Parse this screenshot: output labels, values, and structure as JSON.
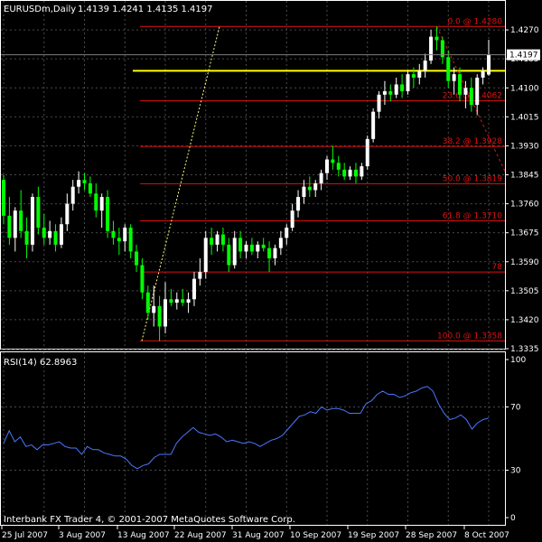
{
  "header": {
    "symbol": "EURUSDm,Daily",
    "ohlc": "1.4139 1.4241 1.4135 1.4197"
  },
  "rsi_header": "RSI(14) 62.8963",
  "footer": "Interbank FX Trader 4, © 2001-2007 MetaQuotes Software Corp.",
  "current_price_label": "1.4197",
  "colors": {
    "background": "#000000",
    "frame": "#ffffff",
    "bull": "#ffffff",
    "bear": "#00ff00",
    "fib": "#e01010",
    "horizontal_line": "#ffff00",
    "rsi": "#4a78ff"
  },
  "chart_data": [
    {
      "type": "candlestick",
      "title": "EURUSDm,Daily",
      "ylim": [
        1.3335,
        1.4355
      ],
      "y_ticks": [
        "1.4270",
        "1.4185",
        "1.4100",
        "1.4015",
        "1.3930",
        "1.3845",
        "1.3760",
        "1.3675",
        "1.3590",
        "1.3505",
        "1.3420",
        "1.3335"
      ],
      "x_ticks": [
        "25 Jul 2007",
        "3 Aug 2007",
        "13 Aug 2007",
        "22 Aug 2007",
        "31 Aug 2007",
        "10 Sep 2007",
        "19 Sep 2007",
        "28 Sep 2007",
        "8 Oct 2007"
      ],
      "candles": [
        [
          1.383,
          1.3845,
          1.37,
          1.3725
        ],
        [
          1.3725,
          1.378,
          1.364,
          1.366
        ],
        [
          1.366,
          1.375,
          1.362,
          1.374
        ],
        [
          1.374,
          1.38,
          1.366,
          1.368
        ],
        [
          1.368,
          1.372,
          1.36,
          1.364
        ],
        [
          1.364,
          1.379,
          1.362,
          1.378
        ],
        [
          1.378,
          1.381,
          1.367,
          1.369
        ],
        [
          1.369,
          1.373,
          1.364,
          1.366
        ],
        [
          1.366,
          1.371,
          1.364,
          1.368
        ],
        [
          1.368,
          1.37,
          1.362,
          1.364
        ],
        [
          1.364,
          1.372,
          1.363,
          1.37
        ],
        [
          1.37,
          1.379,
          1.368,
          1.376
        ],
        [
          1.376,
          1.383,
          1.374,
          1.381
        ],
        [
          1.381,
          1.3855,
          1.379,
          1.383
        ],
        [
          1.383,
          1.385,
          1.38,
          1.382
        ],
        [
          1.382,
          1.384,
          1.378,
          1.379
        ],
        [
          1.379,
          1.382,
          1.372,
          1.374
        ],
        [
          1.374,
          1.379,
          1.369,
          1.378
        ],
        [
          1.378,
          1.38,
          1.366,
          1.368
        ],
        [
          1.368,
          1.371,
          1.364,
          1.366
        ],
        [
          1.366,
          1.369,
          1.361,
          1.365
        ],
        [
          1.365,
          1.37,
          1.362,
          1.369
        ],
        [
          1.369,
          1.37,
          1.36,
          1.362
        ],
        [
          1.362,
          1.364,
          1.356,
          1.358
        ],
        [
          1.358,
          1.36,
          1.348,
          1.35
        ],
        [
          1.35,
          1.352,
          1.342,
          1.344
        ],
        [
          1.344,
          1.352,
          1.34,
          1.346
        ],
        [
          1.346,
          1.349,
          1.3358,
          1.34
        ],
        [
          1.34,
          1.353,
          1.338,
          1.348
        ],
        [
          1.348,
          1.351,
          1.346,
          1.347
        ],
        [
          1.347,
          1.35,
          1.345,
          1.348
        ],
        [
          1.348,
          1.351,
          1.346,
          1.347
        ],
        [
          1.347,
          1.35,
          1.344,
          1.348
        ],
        [
          1.348,
          1.356,
          1.346,
          1.354
        ],
        [
          1.354,
          1.36,
          1.352,
          1.356
        ],
        [
          1.356,
          1.368,
          1.354,
          1.366
        ],
        [
          1.366,
          1.369,
          1.361,
          1.364
        ],
        [
          1.364,
          1.368,
          1.362,
          1.367
        ],
        [
          1.367,
          1.369,
          1.362,
          1.364
        ],
        [
          1.364,
          1.366,
          1.356,
          1.358
        ],
        [
          1.358,
          1.368,
          1.357,
          1.366
        ],
        [
          1.366,
          1.368,
          1.36,
          1.362
        ],
        [
          1.362,
          1.365,
          1.36,
          1.364
        ],
        [
          1.364,
          1.366,
          1.361,
          1.362
        ],
        [
          1.362,
          1.365,
          1.36,
          1.364
        ],
        [
          1.364,
          1.366,
          1.362,
          1.363
        ],
        [
          1.363,
          1.365,
          1.356,
          1.36
        ],
        [
          1.36,
          1.364,
          1.358,
          1.363
        ],
        [
          1.363,
          1.368,
          1.361,
          1.366
        ],
        [
          1.366,
          1.37,
          1.364,
          1.369
        ],
        [
          1.369,
          1.376,
          1.368,
          1.374
        ],
        [
          1.374,
          1.38,
          1.372,
          1.378
        ],
        [
          1.378,
          1.383,
          1.376,
          1.381
        ],
        [
          1.381,
          1.384,
          1.378,
          1.38
        ],
        [
          1.38,
          1.383,
          1.378,
          1.382
        ],
        [
          1.382,
          1.386,
          1.38,
          1.385
        ],
        [
          1.385,
          1.39,
          1.383,
          1.389
        ],
        [
          1.389,
          1.393,
          1.386,
          1.388
        ],
        [
          1.388,
          1.39,
          1.384,
          1.386
        ],
        [
          1.386,
          1.388,
          1.383,
          1.384
        ],
        [
          1.384,
          1.387,
          1.383,
          1.386
        ],
        [
          1.386,
          1.388,
          1.382,
          1.384
        ],
        [
          1.384,
          1.388,
          1.383,
          1.387
        ],
        [
          1.387,
          1.396,
          1.386,
          1.395
        ],
        [
          1.395,
          1.404,
          1.394,
          1.403
        ],
        [
          1.403,
          1.409,
          1.401,
          1.408
        ],
        [
          1.408,
          1.412,
          1.405,
          1.409
        ],
        [
          1.409,
          1.411,
          1.406,
          1.408
        ],
        [
          1.408,
          1.413,
          1.407,
          1.411
        ],
        [
          1.411,
          1.414,
          1.407,
          1.409
        ],
        [
          1.409,
          1.415,
          1.408,
          1.414
        ],
        [
          1.414,
          1.416,
          1.41,
          1.413
        ],
        [
          1.413,
          1.417,
          1.411,
          1.415
        ],
        [
          1.415,
          1.42,
          1.413,
          1.418
        ],
        [
          1.418,
          1.427,
          1.417,
          1.425
        ],
        [
          1.425,
          1.428,
          1.421,
          1.424
        ],
        [
          1.424,
          1.425,
          1.417,
          1.419
        ],
        [
          1.419,
          1.421,
          1.41,
          1.412
        ],
        [
          1.412,
          1.416,
          1.408,
          1.414
        ],
        [
          1.414,
          1.416,
          1.406,
          1.408
        ],
        [
          1.408,
          1.412,
          1.404,
          1.41
        ],
        [
          1.41,
          1.413,
          1.403,
          1.405
        ],
        [
          1.405,
          1.414,
          1.402,
          1.413
        ],
        [
          1.413,
          1.416,
          1.411,
          1.415
        ],
        [
          1.4139,
          1.4241,
          1.4135,
          1.4197
        ]
      ],
      "fib_levels": [
        {
          "label": "0.0 @ 1.4280",
          "value": 1.428
        },
        {
          "label": "23.6 @ 1.4062",
          "value": 1.4062
        },
        {
          "label": "38.2 @ 1.3928",
          "value": 1.3928
        },
        {
          "label": "50.0 @ 1.3819",
          "value": 1.3819
        },
        {
          "label": "61.8 @ 1.3710",
          "value": 1.371
        },
        {
          "label": "78",
          "value": 1.356
        },
        {
          "label": "100.0 @ 1.3358",
          "value": 1.3358
        }
      ],
      "horizontal_line_value": 1.415
    },
    {
      "type": "line",
      "title": "RSI(14) 62.8963",
      "ylim": [
        0,
        100
      ],
      "y_ticks": [
        "100",
        "70",
        "30",
        "0"
      ],
      "series": [
        {
          "values": [
            47,
            55,
            48,
            51,
            45,
            46,
            43,
            46,
            46,
            47,
            48,
            45,
            44,
            44,
            40,
            45,
            43,
            43,
            41,
            40,
            39,
            39,
            37,
            33,
            31,
            33,
            34,
            38,
            40,
            40,
            40,
            47,
            51,
            54,
            57,
            54,
            53,
            52,
            53,
            51,
            48,
            49,
            48,
            47,
            48,
            47,
            45,
            47,
            49,
            50,
            52,
            56,
            60,
            64,
            65,
            67,
            66,
            70,
            68,
            69,
            69,
            68,
            66,
            66,
            66,
            72,
            74,
            78,
            80,
            78,
            78,
            76,
            77,
            79,
            80,
            82,
            83,
            80,
            72,
            66,
            62,
            63,
            65,
            62,
            56,
            60,
            62,
            63
          ]
        }
      ]
    }
  ]
}
